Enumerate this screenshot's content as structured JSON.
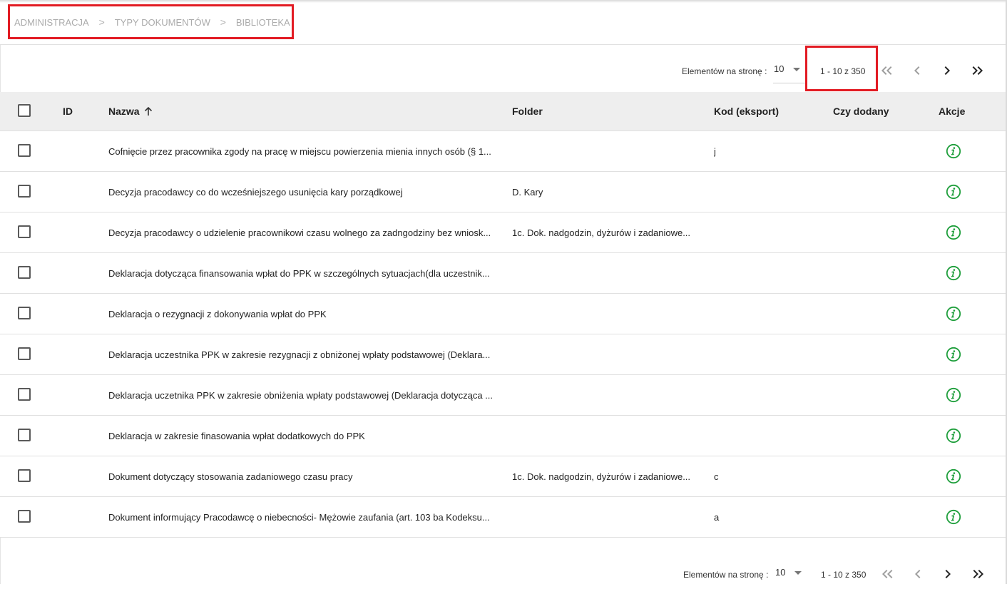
{
  "breadcrumb": [
    "ADMINISTRACJA",
    "TYPY DOKUMENTÓW",
    "BIBLIOTEKA"
  ],
  "breadcrumb_separator": ">",
  "pagination": {
    "label": "Elementów na stronę :",
    "per_page": "10",
    "range": "1 - 10 z 350",
    "buttons": [
      "first-page",
      "previous-page",
      "next-page",
      "last-page"
    ]
  },
  "table": {
    "columns": {
      "id": "ID",
      "name": "Nazwa",
      "folder": "Folder",
      "code": "Kod (eksport)",
      "added": "Czy dodany",
      "actions": "Akcje"
    },
    "sort": {
      "column": "Nazwa",
      "direction": "ascending"
    },
    "rows": [
      {
        "id": "",
        "name": "Cofnięcie przez pracownika zgody na pracę w miejscu powierzenia mienia innych osób (§ 1...",
        "folder": "",
        "code": "j",
        "added": ""
      },
      {
        "id": "",
        "name": "Decyzja pracodawcy co do wcześniejszego usunięcia kary porządkowej",
        "folder": "D. Kary",
        "code": "",
        "added": ""
      },
      {
        "id": "",
        "name": "Decyzja pracodawcy o udzielenie pracownikowi czasu wolnego za zadngodziny bez wniosk...",
        "folder": "1c. Dok. nadgodzin, dyżurów i zadaniowe...",
        "code": "",
        "added": ""
      },
      {
        "id": "",
        "name": "Deklaracja dotycząca finansowania wpłat do PPK w szczególnych sytuacjach(dla uczestnik...",
        "folder": "",
        "code": "",
        "added": ""
      },
      {
        "id": "",
        "name": "Deklaracja o rezygnacji z dokonywania wpłat do PPK",
        "folder": "",
        "code": "",
        "added": ""
      },
      {
        "id": "",
        "name": "Deklaracja uczestnika PPK w zakresie rezygnacji z obniżonej wpłaty podstawowej (Deklara...",
        "folder": "",
        "code": "",
        "added": ""
      },
      {
        "id": "",
        "name": "Deklaracja uczetnika PPK w zakresie obniżenia wpłaty podstawowej (Deklaracja dotycząca ...",
        "folder": "",
        "code": "",
        "added": ""
      },
      {
        "id": "",
        "name": "Deklaracja w zakresie finasowania wpłat dodatkowych do PPK",
        "folder": "",
        "code": "",
        "added": ""
      },
      {
        "id": "",
        "name": "Dokument dotyczący stosowania zadaniowego czasu pracy",
        "folder": "1c. Dok. nadgodzin, dyżurów i zadaniowe...",
        "code": "c",
        "added": ""
      },
      {
        "id": "",
        "name": "Dokument informujący Pracodawcę o niebecności- Mężowie zaufania (art. 103 ba Kodeksu...",
        "folder": "",
        "code": "a",
        "added": ""
      }
    ]
  },
  "colors": {
    "highlight_box": "#e21b23",
    "info_icon": "#1e9e3b",
    "header_bg": "#eeeeee",
    "breadcrumb_text": "#ababab"
  },
  "icons": {
    "row_action": "info-icon",
    "sort": "arrow-up-icon",
    "first": "double-chevron-left-icon",
    "prev": "chevron-left-icon",
    "next": "chevron-right-icon",
    "last": "double-chevron-right-icon"
  }
}
